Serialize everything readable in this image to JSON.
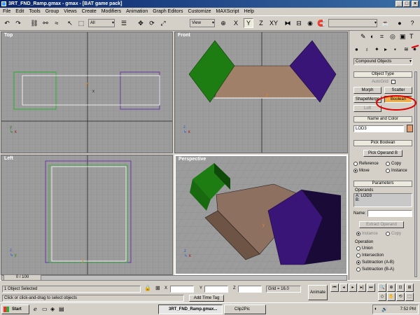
{
  "window": {
    "title": "3RT_FND_Ramp.gmax - gmax - [BAT game pack]"
  },
  "menu": [
    "File",
    "Edit",
    "Tools",
    "Group",
    "Views",
    "Create",
    "Modifiers",
    "Animation",
    "Graph Editors",
    "Customize",
    "MAXScript",
    "Help"
  ],
  "toolbar": {
    "selection_filter": "All",
    "ref_coord": "View"
  },
  "viewports": {
    "top": "Top",
    "front": "Front",
    "left": "Left",
    "perspective": "Perspective"
  },
  "panel": {
    "category": "Compound Objects",
    "object_type": {
      "header": "Object Type",
      "autogrid": "AutoGrid",
      "buttons": [
        "Morph",
        "Scatter",
        "ShapeMerge",
        "Boolean",
        "Loft"
      ]
    },
    "name_color": {
      "header": "Name and Color",
      "name": "LOD3",
      "color": "#e39b70"
    },
    "pick_boolean": {
      "header": "Pick Boolean",
      "button": "Pick Operand B",
      "options": [
        "Reference",
        "Copy",
        "Move",
        "Instance"
      ]
    },
    "parameters": {
      "header": "Parameters",
      "operands_label": "Operands",
      "operands": [
        "A: LOD3",
        "B:"
      ],
      "name_label": "Name:",
      "extract_button": "Extract Operand",
      "extract_options": [
        "Instance",
        "Copy"
      ],
      "operation_label": "Operation",
      "operations": [
        "Union",
        "Intersection",
        "Subtraction (A-B)",
        "Subtraction (B-A)"
      ],
      "selected_operation": "Subtraction (A-B)"
    }
  },
  "timeslider": {
    "frame": "0 / 100"
  },
  "status": {
    "selection": "1 Object Selected",
    "prompt": "Click or click-and-drag to select objects",
    "x_label": "X",
    "y_label": "Y",
    "z_label": "Z",
    "grid": "Grid = 16.0",
    "add_time_tag": "Add Time Tag",
    "animate": "Animate"
  },
  "taskbar": {
    "start": "Start",
    "tasks": [
      "3RT_FND_Ramp.gmax...",
      "Clip2Pic"
    ],
    "clock": "7:52 PM"
  },
  "colors": {
    "green": "#1e7d12",
    "purple": "#3a1578",
    "ramp": "#9c7d64",
    "annotation": "#e00000"
  }
}
